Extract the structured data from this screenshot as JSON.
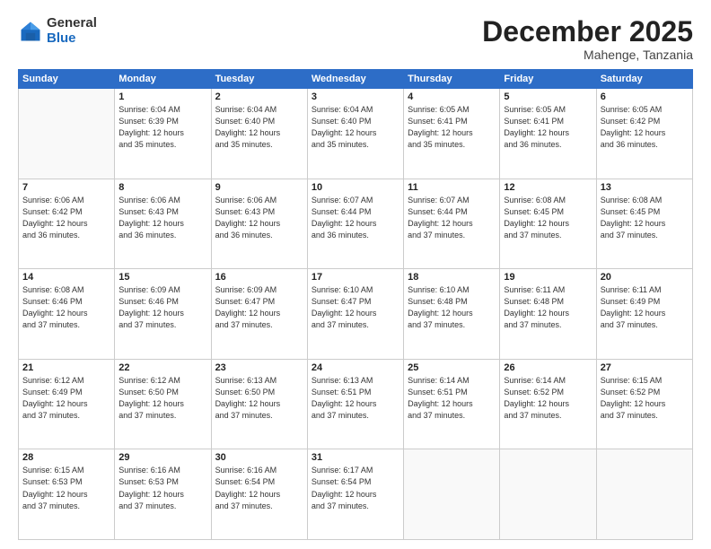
{
  "logo": {
    "general": "General",
    "blue": "Blue"
  },
  "header": {
    "month": "December 2025",
    "location": "Mahenge, Tanzania"
  },
  "weekdays": [
    "Sunday",
    "Monday",
    "Tuesday",
    "Wednesday",
    "Thursday",
    "Friday",
    "Saturday"
  ],
  "weeks": [
    [
      {
        "day": "",
        "info": ""
      },
      {
        "day": "1",
        "info": "Sunrise: 6:04 AM\nSunset: 6:39 PM\nDaylight: 12 hours\nand 35 minutes."
      },
      {
        "day": "2",
        "info": "Sunrise: 6:04 AM\nSunset: 6:40 PM\nDaylight: 12 hours\nand 35 minutes."
      },
      {
        "day": "3",
        "info": "Sunrise: 6:04 AM\nSunset: 6:40 PM\nDaylight: 12 hours\nand 35 minutes."
      },
      {
        "day": "4",
        "info": "Sunrise: 6:05 AM\nSunset: 6:41 PM\nDaylight: 12 hours\nand 35 minutes."
      },
      {
        "day": "5",
        "info": "Sunrise: 6:05 AM\nSunset: 6:41 PM\nDaylight: 12 hours\nand 36 minutes."
      },
      {
        "day": "6",
        "info": "Sunrise: 6:05 AM\nSunset: 6:42 PM\nDaylight: 12 hours\nand 36 minutes."
      }
    ],
    [
      {
        "day": "7",
        "info": "Sunrise: 6:06 AM\nSunset: 6:42 PM\nDaylight: 12 hours\nand 36 minutes."
      },
      {
        "day": "8",
        "info": "Sunrise: 6:06 AM\nSunset: 6:43 PM\nDaylight: 12 hours\nand 36 minutes."
      },
      {
        "day": "9",
        "info": "Sunrise: 6:06 AM\nSunset: 6:43 PM\nDaylight: 12 hours\nand 36 minutes."
      },
      {
        "day": "10",
        "info": "Sunrise: 6:07 AM\nSunset: 6:44 PM\nDaylight: 12 hours\nand 36 minutes."
      },
      {
        "day": "11",
        "info": "Sunrise: 6:07 AM\nSunset: 6:44 PM\nDaylight: 12 hours\nand 37 minutes."
      },
      {
        "day": "12",
        "info": "Sunrise: 6:08 AM\nSunset: 6:45 PM\nDaylight: 12 hours\nand 37 minutes."
      },
      {
        "day": "13",
        "info": "Sunrise: 6:08 AM\nSunset: 6:45 PM\nDaylight: 12 hours\nand 37 minutes."
      }
    ],
    [
      {
        "day": "14",
        "info": "Sunrise: 6:08 AM\nSunset: 6:46 PM\nDaylight: 12 hours\nand 37 minutes."
      },
      {
        "day": "15",
        "info": "Sunrise: 6:09 AM\nSunset: 6:46 PM\nDaylight: 12 hours\nand 37 minutes."
      },
      {
        "day": "16",
        "info": "Sunrise: 6:09 AM\nSunset: 6:47 PM\nDaylight: 12 hours\nand 37 minutes."
      },
      {
        "day": "17",
        "info": "Sunrise: 6:10 AM\nSunset: 6:47 PM\nDaylight: 12 hours\nand 37 minutes."
      },
      {
        "day": "18",
        "info": "Sunrise: 6:10 AM\nSunset: 6:48 PM\nDaylight: 12 hours\nand 37 minutes."
      },
      {
        "day": "19",
        "info": "Sunrise: 6:11 AM\nSunset: 6:48 PM\nDaylight: 12 hours\nand 37 minutes."
      },
      {
        "day": "20",
        "info": "Sunrise: 6:11 AM\nSunset: 6:49 PM\nDaylight: 12 hours\nand 37 minutes."
      }
    ],
    [
      {
        "day": "21",
        "info": "Sunrise: 6:12 AM\nSunset: 6:49 PM\nDaylight: 12 hours\nand 37 minutes."
      },
      {
        "day": "22",
        "info": "Sunrise: 6:12 AM\nSunset: 6:50 PM\nDaylight: 12 hours\nand 37 minutes."
      },
      {
        "day": "23",
        "info": "Sunrise: 6:13 AM\nSunset: 6:50 PM\nDaylight: 12 hours\nand 37 minutes."
      },
      {
        "day": "24",
        "info": "Sunrise: 6:13 AM\nSunset: 6:51 PM\nDaylight: 12 hours\nand 37 minutes."
      },
      {
        "day": "25",
        "info": "Sunrise: 6:14 AM\nSunset: 6:51 PM\nDaylight: 12 hours\nand 37 minutes."
      },
      {
        "day": "26",
        "info": "Sunrise: 6:14 AM\nSunset: 6:52 PM\nDaylight: 12 hours\nand 37 minutes."
      },
      {
        "day": "27",
        "info": "Sunrise: 6:15 AM\nSunset: 6:52 PM\nDaylight: 12 hours\nand 37 minutes."
      }
    ],
    [
      {
        "day": "28",
        "info": "Sunrise: 6:15 AM\nSunset: 6:53 PM\nDaylight: 12 hours\nand 37 minutes."
      },
      {
        "day": "29",
        "info": "Sunrise: 6:16 AM\nSunset: 6:53 PM\nDaylight: 12 hours\nand 37 minutes."
      },
      {
        "day": "30",
        "info": "Sunrise: 6:16 AM\nSunset: 6:54 PM\nDaylight: 12 hours\nand 37 minutes."
      },
      {
        "day": "31",
        "info": "Sunrise: 6:17 AM\nSunset: 6:54 PM\nDaylight: 12 hours\nand 37 minutes."
      },
      {
        "day": "",
        "info": ""
      },
      {
        "day": "",
        "info": ""
      },
      {
        "day": "",
        "info": ""
      }
    ]
  ]
}
